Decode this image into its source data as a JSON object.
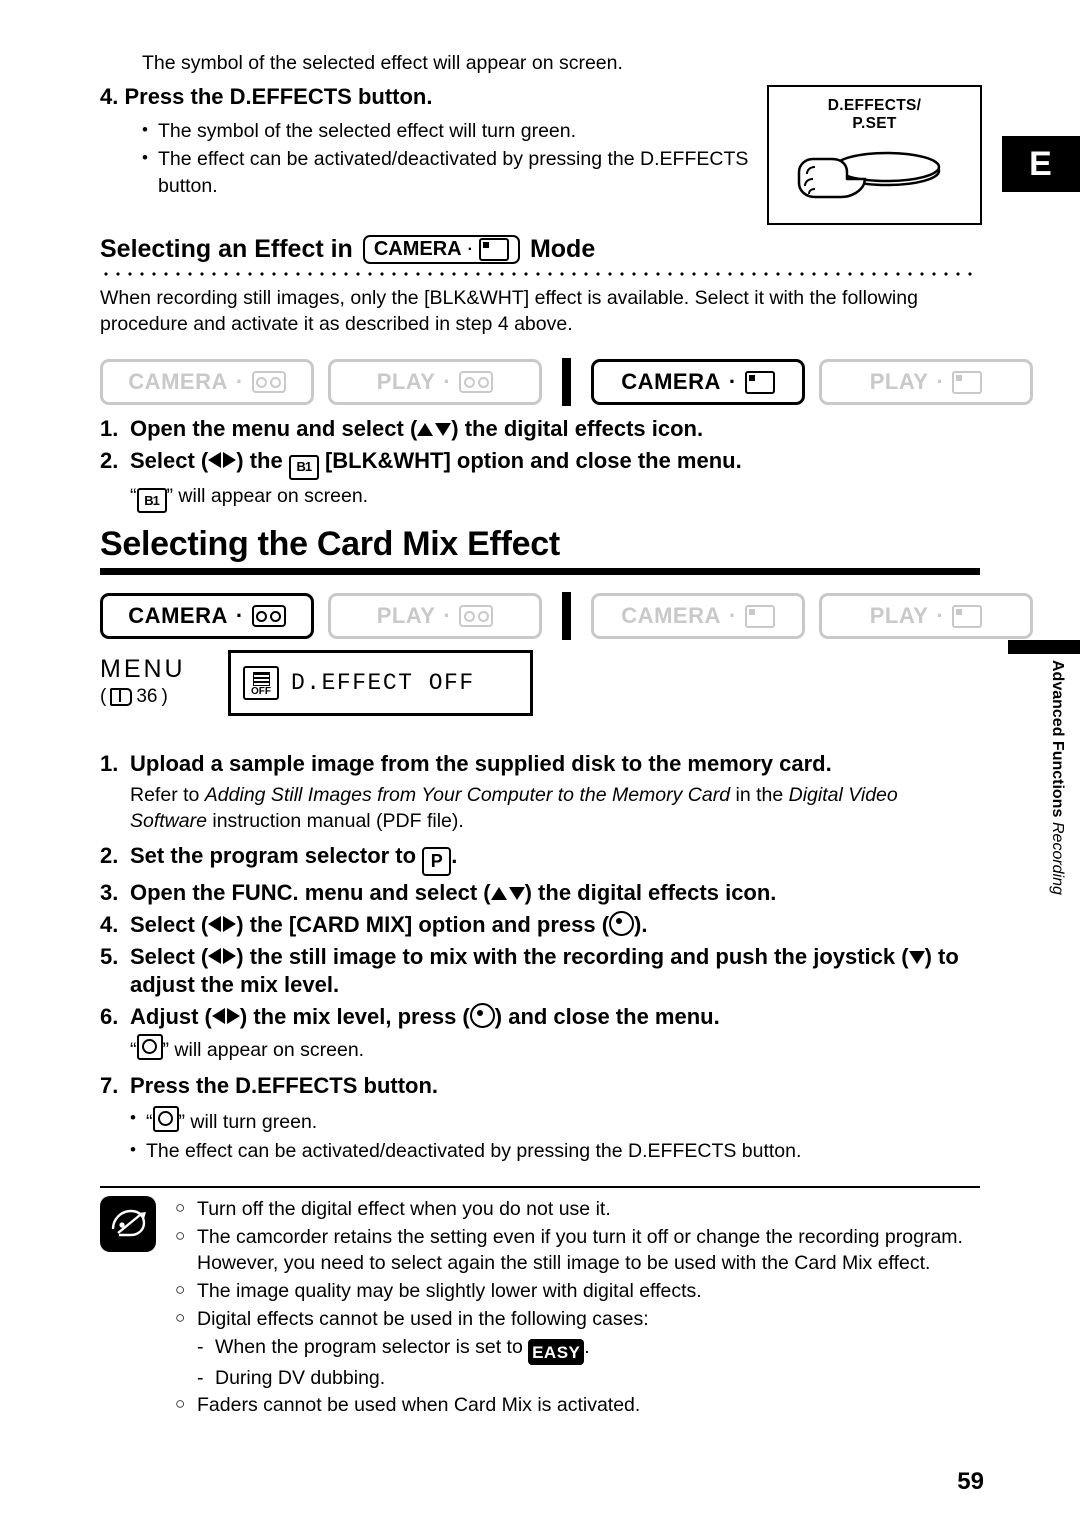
{
  "lang_tab": "E",
  "page_number": "59",
  "intro_line": "The symbol of the selected effect will appear on screen.",
  "step4": {
    "heading": "4. Press the D.EFFECTS button.",
    "bullets": [
      "The symbol of the selected effect will turn green.",
      "The effect can be activated/deactivated by pressing the D.EFFECTS button."
    ]
  },
  "deffects_illustration": {
    "label_line1": "D.EFFECTS/",
    "label_line2": "P.SET"
  },
  "section1": {
    "heading_pre": "Selecting an Effect in",
    "heading_pill": "CAMERA",
    "heading_post": "Mode",
    "paragraph": "When recording still images, only the [BLK&WHT] effect is available. Select it with the following procedure and activate it as described in step 4 above.",
    "mode_tabs": [
      {
        "label": "CAMERA",
        "icon": "tape-icon",
        "active": false
      },
      {
        "label": "PLAY",
        "icon": "tape-icon",
        "active": false
      },
      {
        "label": "CAMERA",
        "icon": "card-icon",
        "active": true
      },
      {
        "label": "PLAY",
        "icon": "card-icon",
        "active": false
      }
    ],
    "steps": [
      {
        "n": "1.",
        "pre": "Open the menu and select (",
        "post": ") the digital effects icon.",
        "arrows": "updown"
      },
      {
        "n": "2.",
        "pre": "Select (",
        "mid": ") the",
        "post": "[BLK&WHT] option and close the menu.",
        "arrows": "leftright"
      }
    ],
    "note": "“     ” will appear on screen."
  },
  "section2": {
    "title": "Selecting the Card Mix Effect",
    "mode_tabs": [
      {
        "label": "CAMERA",
        "icon": "tape-icon",
        "active": true
      },
      {
        "label": "PLAY",
        "icon": "tape-icon",
        "active": false
      },
      {
        "label": "CAMERA",
        "icon": "card-icon",
        "active": false
      },
      {
        "label": "PLAY",
        "icon": "card-icon",
        "active": false
      }
    ],
    "menu": {
      "word": "MENU",
      "page_ref": "36",
      "field_value": "D.EFFECT OFF",
      "field_icon_label": "OFF"
    },
    "steps": [
      {
        "n": "1.",
        "text": "Upload a sample image from the supplied disk to the memory card.",
        "sub_prefix": "Refer to ",
        "sub_italic1": "Adding Still Images from Your Computer to the Memory Card",
        "sub_mid": " in the ",
        "sub_italic2": "Digital Video Software",
        "sub_suffix": " instruction manual (PDF file)."
      },
      {
        "n": "2.",
        "pre": "Set the program selector to",
        "post": "."
      },
      {
        "n": "3.",
        "pre": "Open the FUNC. menu and select (",
        "post": ") the digital effects icon."
      },
      {
        "n": "4.",
        "pre": "Select (",
        "mid": ") the [CARD MIX] option and press (",
        "post": ")."
      },
      {
        "n": "5.",
        "pre": "Select (",
        "mid": ") the still image to mix with the recording and push the joystick (",
        "post": ") to adjust the mix level."
      },
      {
        "n": "6.",
        "pre": "Adjust (",
        "mid": ") the mix level, press (",
        "post": ") and close the menu."
      },
      {
        "n": "7.",
        "text": "Press the D.EFFECTS button."
      }
    ],
    "note_after_6": "“     ” will appear on screen.",
    "step7_bullets": [
      "“     ” will turn green.",
      "The effect can be activated/deactivated by pressing the D.EFFECTS button."
    ]
  },
  "notes": [
    {
      "text": "Turn off the digital effect when you do not use it."
    },
    {
      "text": "The camcorder retains the setting even if you turn it off or change the recording program. However, you need to select again the still image to be used with the Card Mix effect."
    },
    {
      "text": "The image quality may be slightly lower with digital effects."
    },
    {
      "text": "Digital effects cannot be used in the following cases:"
    },
    {
      "text": "Faders cannot be used when Card Mix is activated."
    }
  ],
  "notes_sub": [
    {
      "pre": "When the program selector is set to",
      "post": "."
    },
    {
      "pre": "During DV dubbing.",
      "post": ""
    }
  ],
  "side_tab": {
    "line_bold": "Advanced Functions",
    "line_italic": "Recording"
  }
}
